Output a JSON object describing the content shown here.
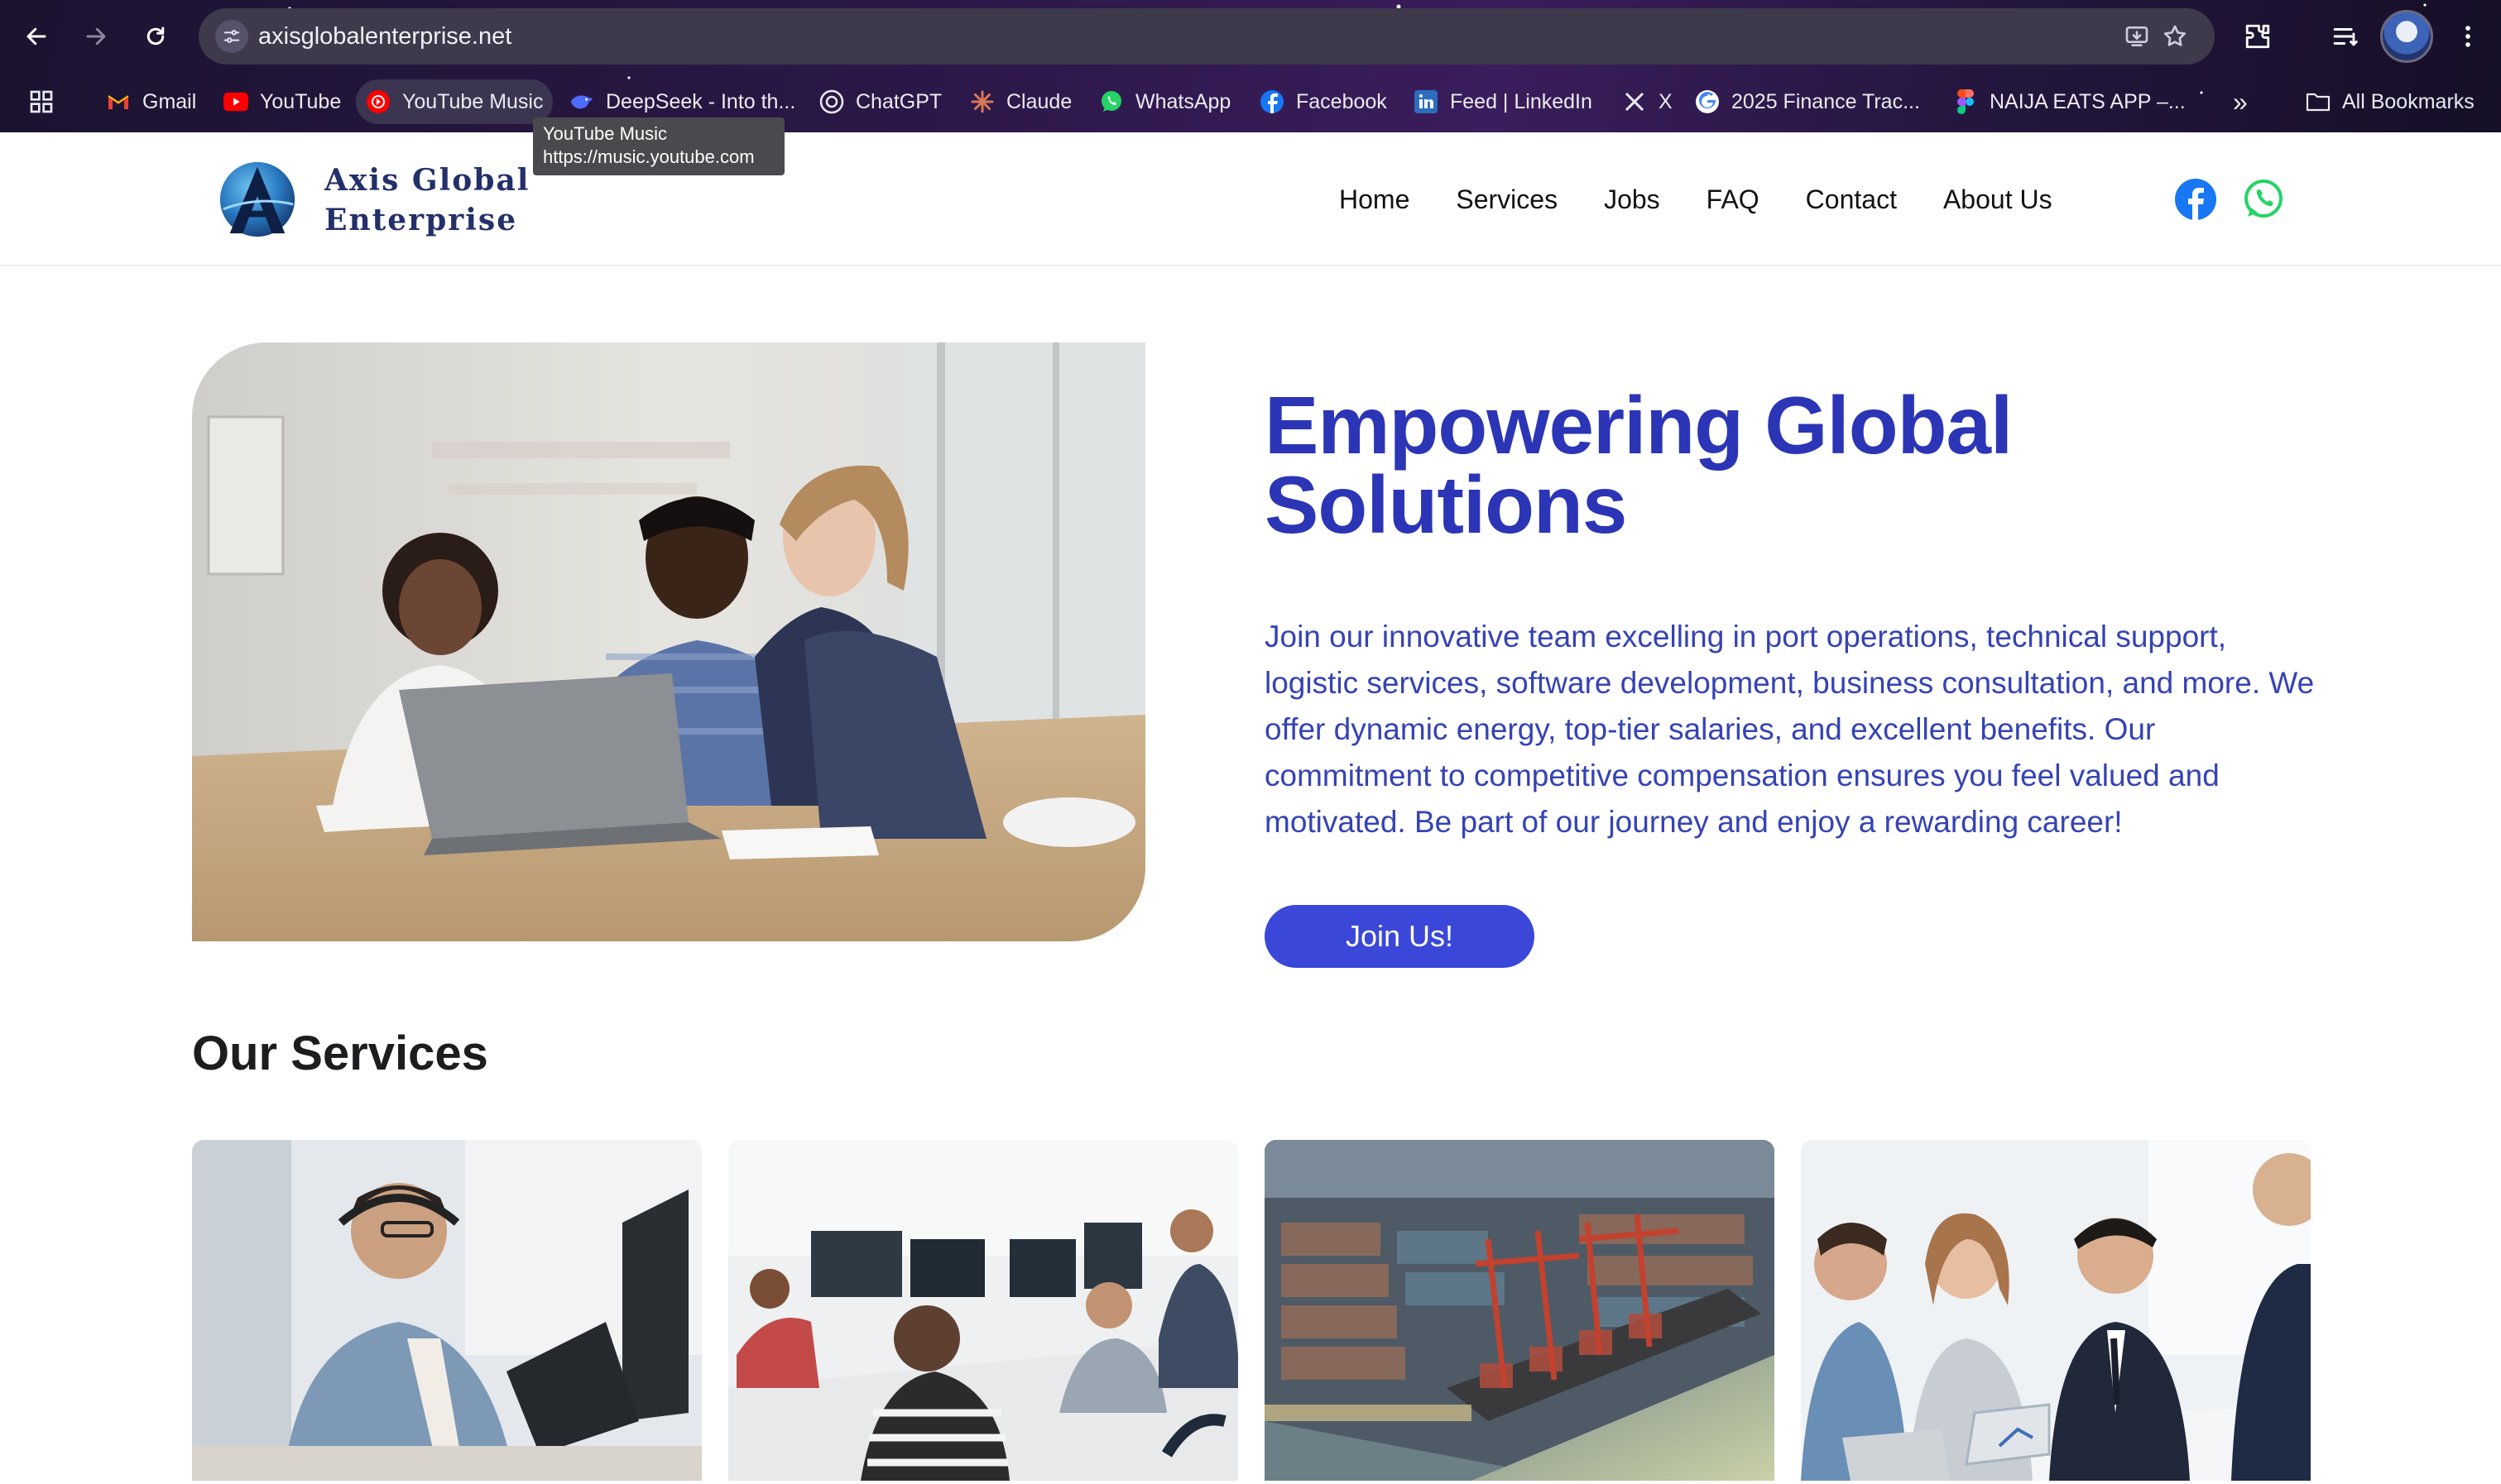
{
  "browser": {
    "url": "axisglobalenterprise.net",
    "bookmarks": [
      {
        "label": "Gmail",
        "icon": "gmail-icon"
      },
      {
        "label": "YouTube",
        "icon": "youtube-icon"
      },
      {
        "label": "YouTube Music",
        "icon": "youtube-music-icon"
      },
      {
        "label": "DeepSeek - Into th...",
        "icon": "deepseek-icon"
      },
      {
        "label": "ChatGPT",
        "icon": "chatgpt-icon"
      },
      {
        "label": "Claude",
        "icon": "claude-icon"
      },
      {
        "label": "WhatsApp",
        "icon": "whatsapp-icon"
      },
      {
        "label": "Facebook",
        "icon": "facebook-icon"
      },
      {
        "label": "Feed | LinkedIn",
        "icon": "linkedin-icon"
      },
      {
        "label": "X",
        "icon": "x-icon"
      },
      {
        "label": "2025 Finance Trac...",
        "icon": "google-icon"
      },
      {
        "label": "NAIJA EATS APP –...",
        "icon": "figma-icon"
      }
    ],
    "overflow_label": "»",
    "all_bookmarks_label": "All Bookmarks",
    "tooltip": {
      "title": "YouTube Music",
      "url": "https://music.youtube.com"
    }
  },
  "site": {
    "logo_line1": "Axis Global",
    "logo_line2": "Enterprise",
    "nav": [
      "Home",
      "Services",
      "Jobs",
      "FAQ",
      "Contact",
      "About Us"
    ],
    "hero": {
      "title_line1": "Empowering Global",
      "title_line2": "Solutions",
      "paragraph": "Join our innovative team excelling in port operations, technical support, logistic services, software development, business consultation, and more. We offer dynamic energy, top-tier salaries, and excellent benefits. Our commitment to competitive compensation ensures you feel valued and motivated. Be part of our journey and enjoy a rewarding career!",
      "cta_label": "Join Us!"
    },
    "services_title": "Our Services"
  },
  "colors": {
    "brand_blue": "#2b35b6",
    "button_blue": "#3a47d8",
    "logo_navy": "#24306a",
    "facebook": "#1877f2",
    "whatsapp": "#25d366"
  }
}
